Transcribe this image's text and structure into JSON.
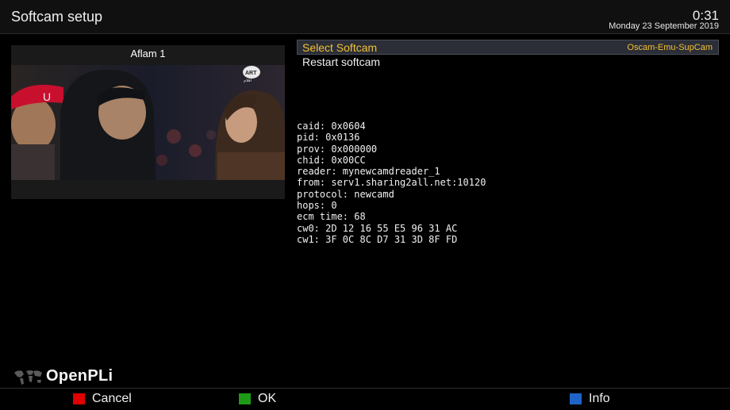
{
  "header": {
    "title": "Softcam setup",
    "time": "0:31",
    "date": "Monday 23 September 2019"
  },
  "pip": {
    "channel_name": "Aflam 1"
  },
  "menu": {
    "items": [
      {
        "label": "Select Softcam",
        "value": "Oscam-Emu-SupCam",
        "selected": true
      },
      {
        "label": "Restart softcam"
      }
    ]
  },
  "ecm_info": [
    "caid: 0x0604",
    "pid: 0x0136",
    "prov: 0x000000",
    "chid: 0x00CC",
    "reader: mynewcamdreader_1",
    "from: serv1.sharing2all.net:10120",
    "protocol: newcamd",
    "hops: 0",
    "ecm time: 68",
    "cw0: 2D 12 16 55 E5 96 31 AC",
    "cw1: 3F 0C 8C D7 31 3D 8F FD"
  ],
  "logo": {
    "text": "OpenPLi"
  },
  "buttons": {
    "red": {
      "label": "Cancel",
      "color": "#e00000"
    },
    "green": {
      "label": "OK",
      "color": "#1e9a16"
    },
    "blue": {
      "label": "Info",
      "color": "#1f63c8"
    }
  },
  "colors": {
    "accent": "#f2c033",
    "background": "#000000",
    "selection": "#2b2e36"
  },
  "icons": [
    "channel-logo-icon",
    "world-map-icon"
  ]
}
